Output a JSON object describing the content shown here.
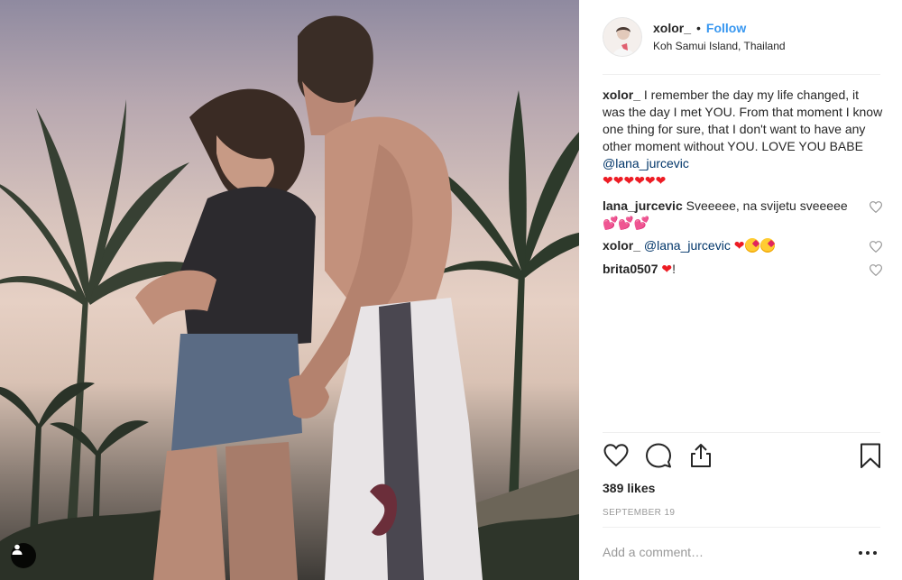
{
  "post": {
    "username": "xolor_",
    "dot": "•",
    "follow_label": "Follow",
    "location": "Koh Samui Island, Thailand"
  },
  "caption": {
    "user": "xolor_",
    "text": "I remember the day my life changed, it was the day I met YOU. From that moment I know one thing for sure, that I don't want to have any other moment without YOU. LOVE YOU BABE",
    "mention": "@lana_jurcevic",
    "emoji": "❤❤❤❤❤❤"
  },
  "comments": [
    {
      "user": "lana_jurcevic",
      "text": "Sveeeee, na svijetu sveeeee",
      "emoji": "💕💕💕"
    },
    {
      "user": "xolor_",
      "mention": "@lana_jurcevic",
      "emoji": "❤"
    },
    {
      "user": "brita0507",
      "emoji": "❤",
      "text": "!"
    }
  ],
  "likes_text": "389 likes",
  "date_text": "SEPTEMBER 19",
  "add_comment_placeholder": "Add a comment…",
  "icons": {
    "like": "heart-outline-icon",
    "comment": "speech-bubble-icon",
    "share": "share-icon",
    "save": "bookmark-icon",
    "more": "more-options-icon",
    "tag": "user-tag-icon"
  },
  "colors": {
    "link_blue": "#3897f0",
    "mention": "#003569",
    "heart_red": "#ed1c24",
    "muted": "#999999",
    "text": "#262626"
  }
}
